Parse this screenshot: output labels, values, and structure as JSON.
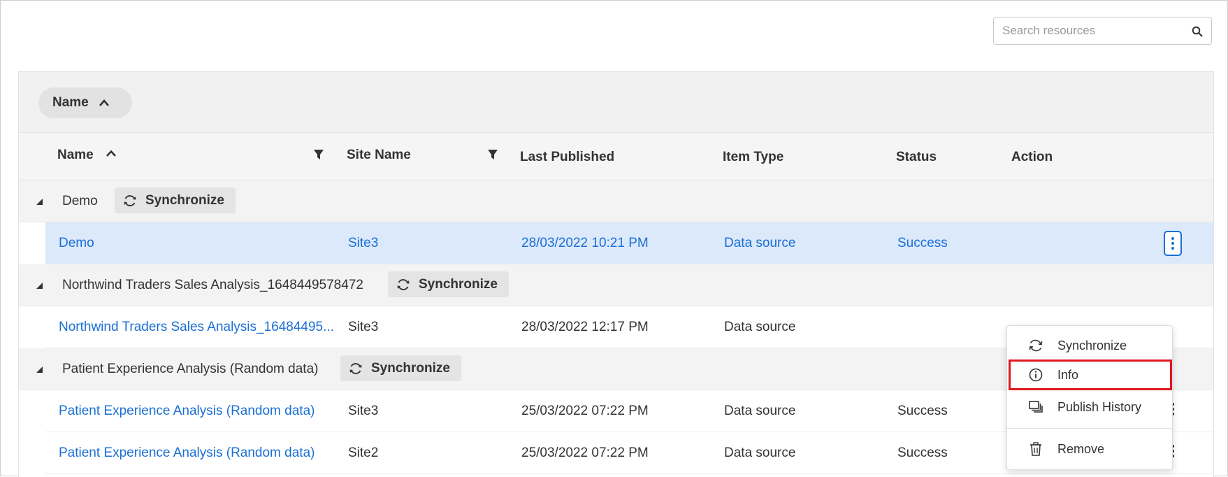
{
  "search": {
    "placeholder": "Search resources",
    "icon": "search-icon"
  },
  "group_panel": {
    "chip_label": "Name",
    "chip_sort": "ascending"
  },
  "columns": {
    "name": "Name",
    "site_name": "Site Name",
    "last_published": "Last Published",
    "item_type": "Item Type",
    "status": "Status",
    "action": "Action"
  },
  "groups": [
    {
      "label": "Demo",
      "sync_label": "Synchronize",
      "rows": [
        {
          "name": "Demo",
          "site": "Site3",
          "published": "28/03/2022 10:21 PM",
          "type": "Data source",
          "status": "Success"
        }
      ]
    },
    {
      "label": "Northwind Traders Sales Analysis_1648449578472",
      "sync_label": "Synchronize",
      "rows": [
        {
          "name": "Northwind Traders Sales Analysis_16484495...",
          "site": "Site3",
          "published": "28/03/2022 12:17 PM",
          "type": "Data source",
          "status": ""
        }
      ]
    },
    {
      "label": "Patient Experience Analysis (Random data)",
      "sync_label": "Synchronize",
      "rows": [
        {
          "name": "Patient Experience Analysis (Random data)",
          "site": "Site3",
          "published": "25/03/2022 07:22 PM",
          "type": "Data source",
          "status": "Success"
        },
        {
          "name": "Patient Experience Analysis (Random data)",
          "site": "Site2",
          "published": "25/03/2022 07:22 PM",
          "type": "Data source",
          "status": "Success"
        }
      ]
    }
  ],
  "context_menu": {
    "items": [
      {
        "label": "Synchronize",
        "icon": "sync-icon"
      },
      {
        "label": "Info",
        "icon": "info-icon",
        "highlighted": true
      },
      {
        "label": "Publish History",
        "icon": "publish-history-icon"
      },
      {
        "label": "Remove",
        "icon": "trash-icon"
      }
    ]
  },
  "colors": {
    "link": "#1a6fd6",
    "selected_row": "#dce9fb",
    "highlight_box": "#e0161e"
  }
}
